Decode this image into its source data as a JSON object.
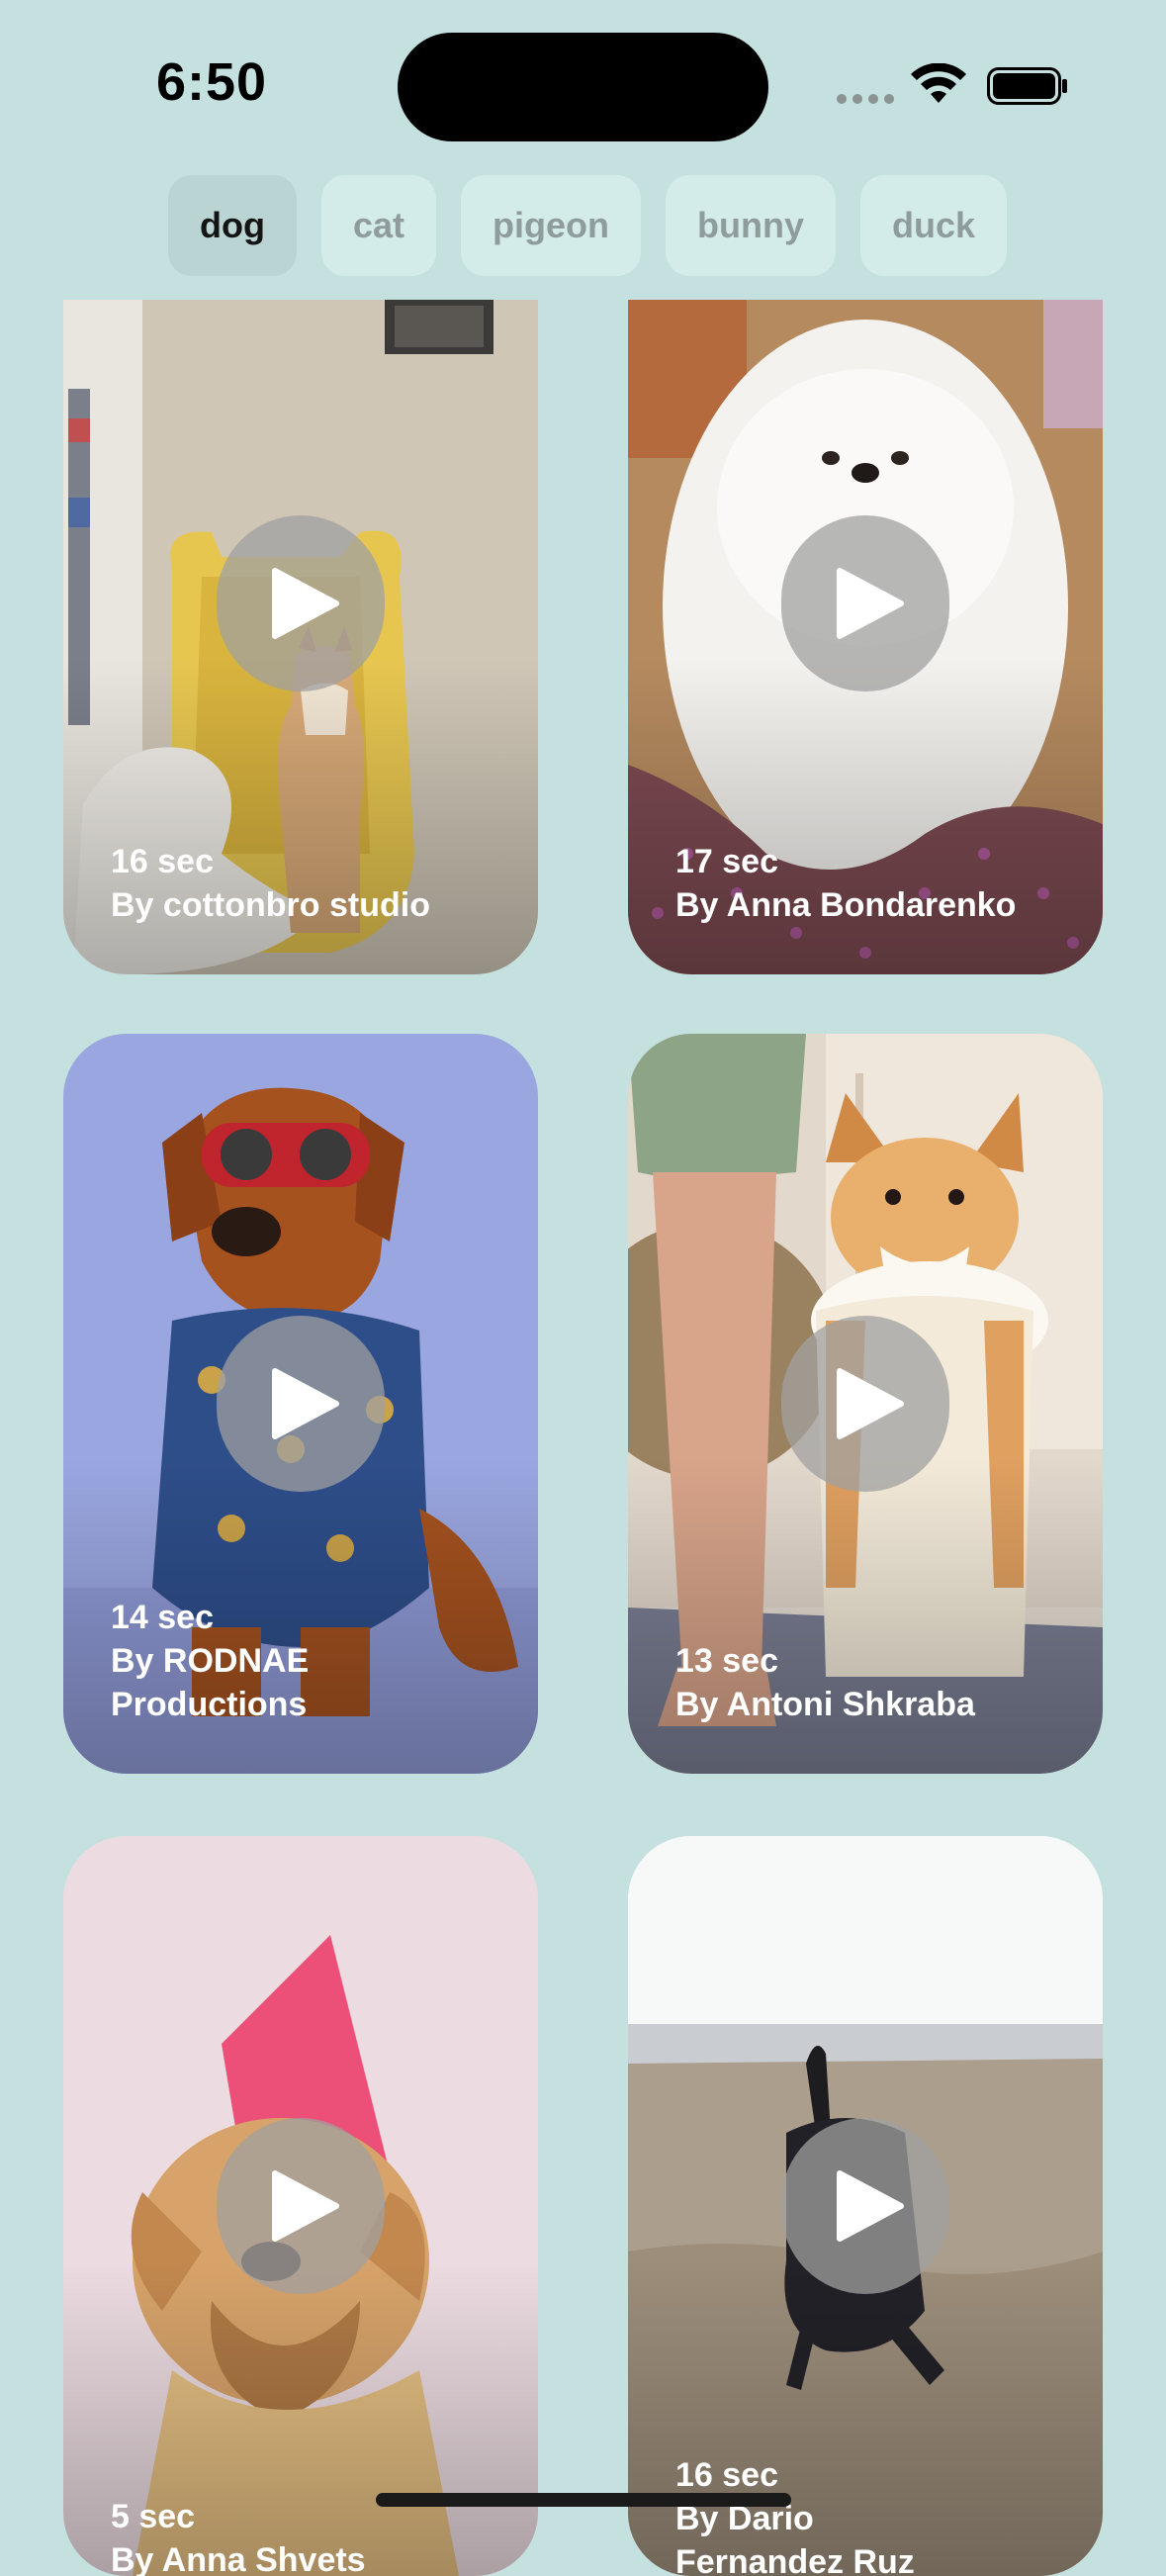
{
  "status_bar": {
    "time": "6:50"
  },
  "categories": [
    {
      "label": "dog",
      "active": true
    },
    {
      "label": "cat",
      "active": false
    },
    {
      "label": "pigeon",
      "active": false
    },
    {
      "label": "bunny",
      "active": false
    },
    {
      "label": "duck",
      "active": false
    }
  ],
  "videos": [
    {
      "duration": "16 sec",
      "author_line1": "By cottonbro studio",
      "author_line2": ""
    },
    {
      "duration": "17 sec",
      "author_line1": "By Anna Bondarenko",
      "author_line2": ""
    },
    {
      "duration": "14 sec",
      "author_line1": "By RODNAE",
      "author_line2": "Productions"
    },
    {
      "duration": "13 sec",
      "author_line1": "By Antoni Shkraba",
      "author_line2": ""
    },
    {
      "duration": "5 sec",
      "author_line1": "By Anna Shvets",
      "author_line2": ""
    },
    {
      "duration": "16 sec",
      "author_line1": "By Dario",
      "author_line2": "Fernandez Ruz"
    }
  ],
  "icons": {
    "play": "play-icon",
    "wifi": "wifi-icon",
    "battery": "battery-icon"
  },
  "colors": {
    "background": "#c4e0df",
    "chip_active": "#b9d4d2",
    "chip_inactive": "#d3ebe9"
  }
}
